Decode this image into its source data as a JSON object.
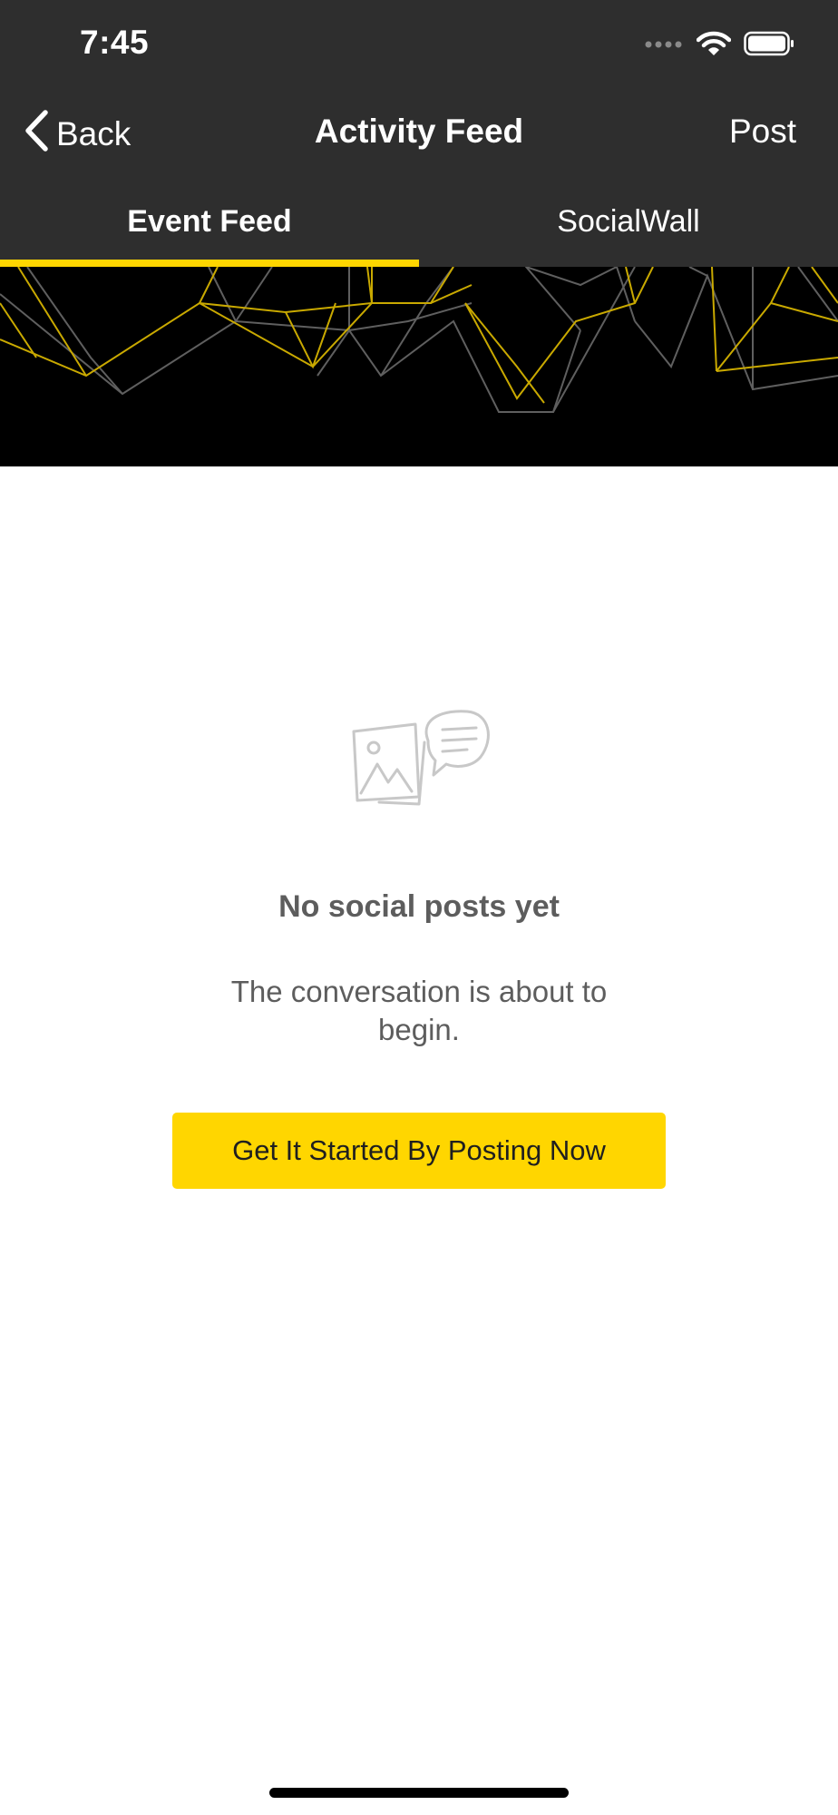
{
  "status_bar": {
    "time": "7:45"
  },
  "nav": {
    "back_label": "Back",
    "title": "Activity Feed",
    "post_label": "Post"
  },
  "tabs": [
    {
      "label": "Event Feed",
      "active": true
    },
    {
      "label": "SocialWall",
      "active": false
    }
  ],
  "empty_state": {
    "icon": "social-posts-empty-icon",
    "title": "No social posts yet",
    "subtitle": "The conversation is about to begin.",
    "button_label": "Get It Started By Posting Now"
  },
  "colors": {
    "header_bg": "#2e2e2e",
    "accent": "#ffd600",
    "banner_bg": "#000000",
    "muted_text": "#5d5d5d"
  }
}
